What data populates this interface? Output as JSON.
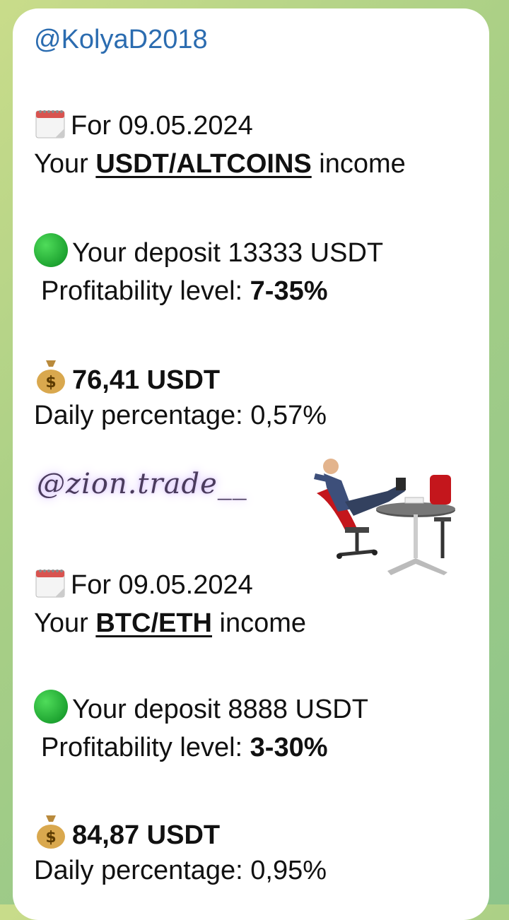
{
  "message": {
    "sender": "@KolyaD2018",
    "blocks": [
      {
        "date_label": "For 09.05.2024",
        "income_prefix": "Your ",
        "pair": "USDT/ALTCOINS",
        "income_suffix": " income",
        "deposit": "Your deposit 13333 USDT",
        "profit_label": "Profitability level: ",
        "profit_value": "7-35%",
        "amount": "76,41 USDT",
        "daily": "Daily percentage: 0,57%"
      },
      {
        "date_label": "For 09.05.2024",
        "income_prefix": "Your ",
        "pair": "BTC/ETH",
        "income_suffix": " income",
        "deposit": "Your deposit 8888 USDT",
        "profit_label": "Profitability level: ",
        "profit_value": "3-30%",
        "amount": "84,87 USDT",
        "daily": "Daily percentage: 0,95%"
      }
    ],
    "watermark": "@zion.trade__"
  },
  "icons": [
    "calendar-icon",
    "green-circle-icon",
    "money-bag-icon"
  ],
  "colors": {
    "sender": "#2b6cb0",
    "bubble": "#ffffff",
    "accent_green": "#1ea431"
  }
}
